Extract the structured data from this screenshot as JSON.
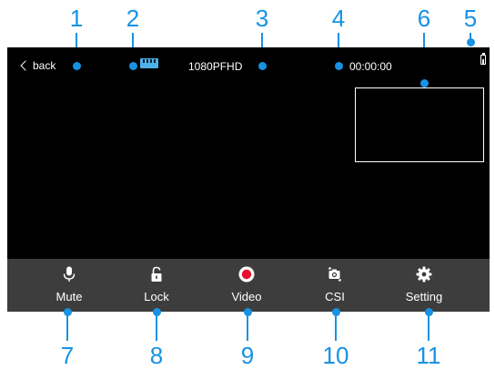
{
  "topbar": {
    "back_label": "back",
    "storage_icon": "sd-card-icon",
    "resolution": "1080PFHD",
    "timer": "00:00:00",
    "battery_icon": "battery-icon"
  },
  "toolbar": {
    "items": [
      {
        "label": "Mute",
        "icon": "microphone-icon"
      },
      {
        "label": "Lock",
        "icon": "lock-icon"
      },
      {
        "label": "Video",
        "icon": "record-icon"
      },
      {
        "label": "CSI",
        "icon": "camera-switch-icon"
      },
      {
        "label": "Setting",
        "icon": "gear-icon"
      }
    ]
  },
  "callouts": {
    "top": [
      "1",
      "2",
      "3",
      "4",
      "6",
      "5"
    ],
    "bottom": [
      "7",
      "8",
      "9",
      "10",
      "11"
    ]
  },
  "colors": {
    "callout": "#1892e3",
    "screen": "#000000",
    "toolbar": "#3d3d3d",
    "record": "#e8102a",
    "storage": "#4fb1ec"
  }
}
